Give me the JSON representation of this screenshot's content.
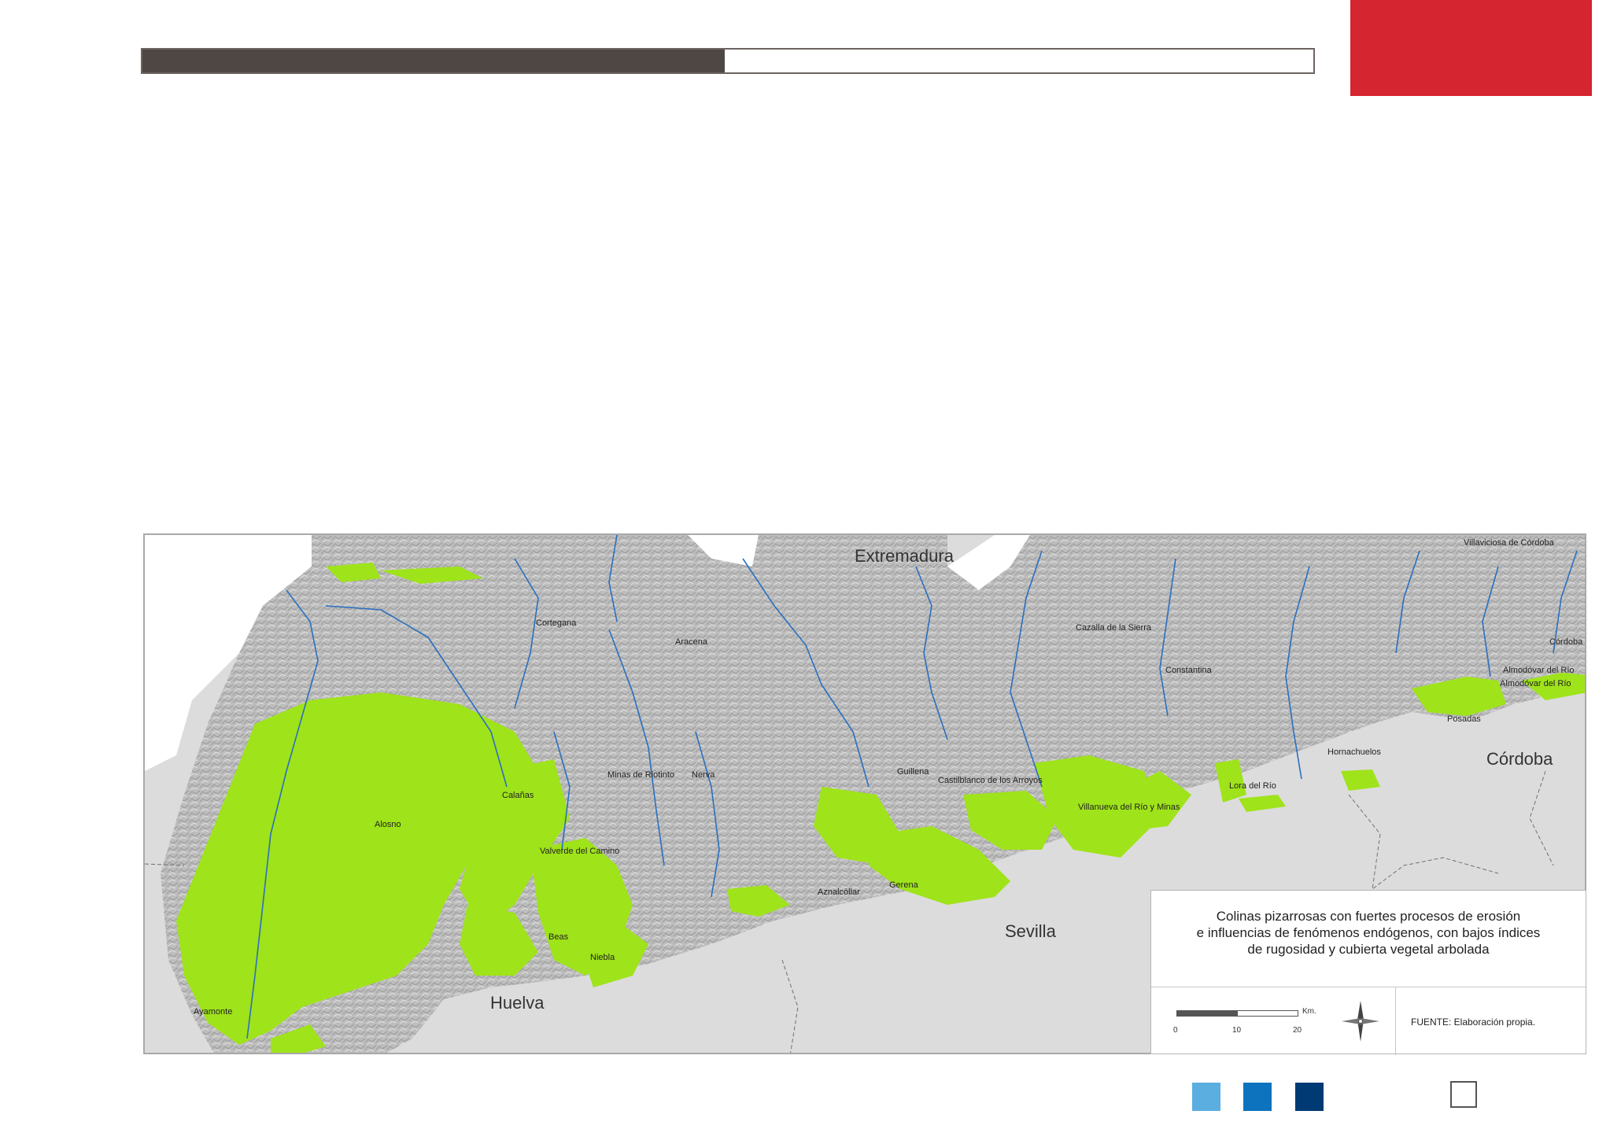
{
  "progress": {
    "fraction": 0.497,
    "fill_color": "#4f4744",
    "border_color": "#6b6461"
  },
  "corner_block_color": "#d42530",
  "map": {
    "colors": {
      "relief": "#bcbcbc",
      "outside": "#dcdcdc",
      "highlight": "#9fe31a",
      "rivers": "#2a6fc0"
    },
    "regions": {
      "north": "Extremadura",
      "sevilla": "Sevilla",
      "huelva": "Huelva",
      "cordoba": "Córdoba"
    },
    "places": {
      "villaviciosa": "Villaviciosa de Córdoba",
      "cortegana": "Cortegana",
      "aracena": "Aracena",
      "cazalla": "Cazalla de la Sierra",
      "constantina": "Constantina",
      "cordoba_top": "Córdoba",
      "almodovar1": "Almodóvar del Río",
      "almodovar2": "Almodóvar del Río",
      "posadas": "Posadas",
      "hornachuelos": "Hornachuelos",
      "guillena": "Guillena",
      "castilblanco": "Castilblanco de los Arroyos",
      "lora": "Lora del Río",
      "villanueva": "Villanueva del Río y Minas",
      "minas": "Minas de Riotinto",
      "nerva": "Nerva",
      "calanas": "Calañas",
      "alosno": "Alosno",
      "valverde": "Valverde del Camino",
      "aznalcollar": "Aznalcóllar",
      "gerena": "Gerena",
      "beas": "Beas",
      "niebla": "Niebla",
      "ayamonte": "Ayamonte"
    }
  },
  "legend": {
    "title_lines": [
      "Colinas pizarrosas con fuertes procesos de erosión",
      "e influencias de fenómenos endógenos, con bajos índices",
      "de rugosidad y cubierta vegetal arbolada"
    ],
    "scale": {
      "unit": "Km.",
      "ticks": [
        "0",
        "10",
        "20"
      ]
    },
    "source": "FUENTE: Elaboración propia."
  },
  "swatches": [
    "#5aaee0",
    "#0d73bf",
    "#003a75"
  ]
}
